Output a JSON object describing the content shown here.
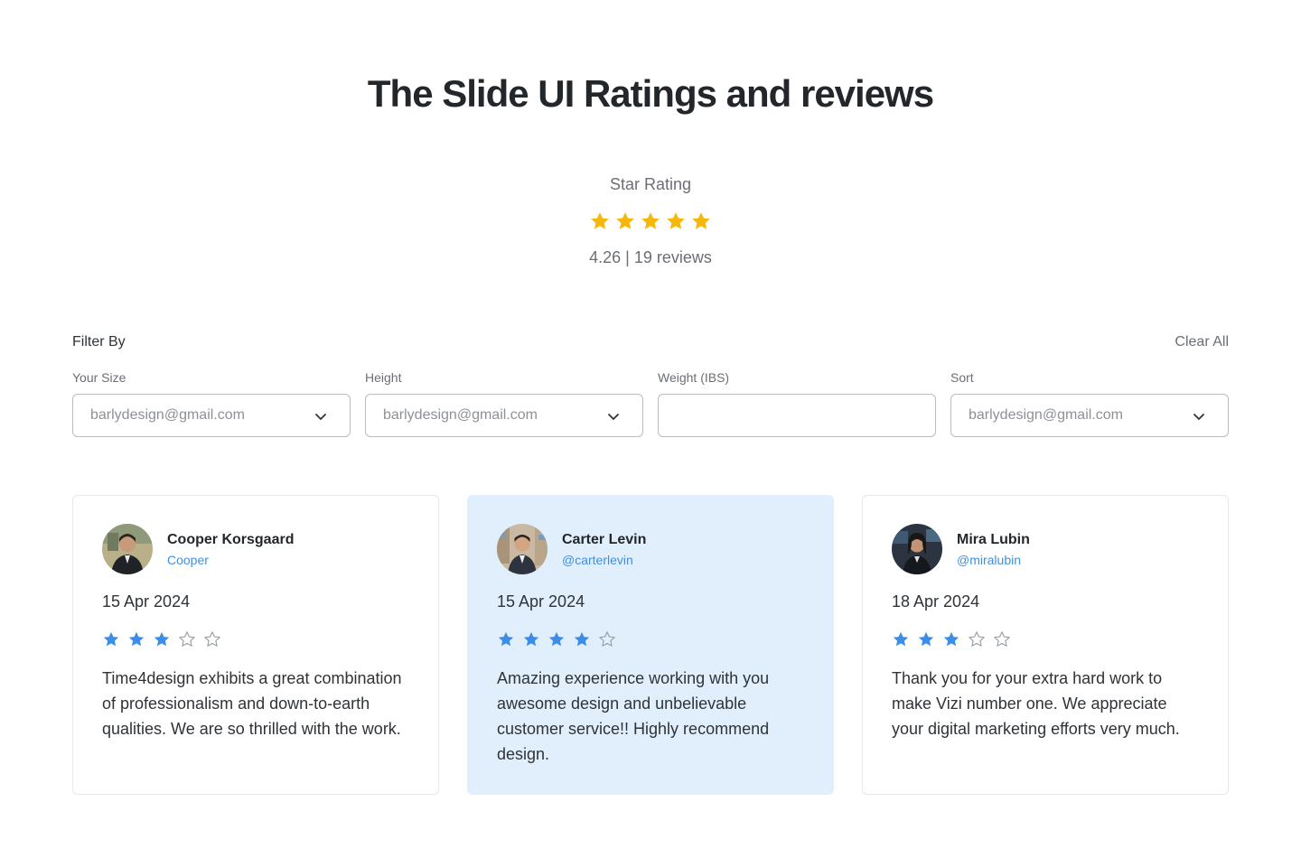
{
  "page_title": "The Slide UI Ratings and reviews",
  "summary": {
    "label": "Star Rating",
    "stars_filled": 5,
    "stars_total": 5,
    "rating_text": "4.26 | 19 reviews",
    "star_color": "#F5B70A"
  },
  "filters": {
    "title": "Filter By",
    "clear_all": "Clear All",
    "fields": [
      {
        "label": "Your Size",
        "value": "barlydesign@gmail.com",
        "has_dropdown": true
      },
      {
        "label": "Height",
        "value": "barlydesign@gmail.com",
        "has_dropdown": true
      },
      {
        "label": "Weight (IBS)",
        "value": "",
        "has_dropdown": false
      },
      {
        "label": "Sort",
        "value": "barlydesign@gmail.com",
        "has_dropdown": true
      }
    ]
  },
  "reviews": [
    {
      "name": "Cooper Korsgaard",
      "handle": "Cooper",
      "date": "15 Apr 2024",
      "rating": 3,
      "text": "Time4design exhibits a great combination of professionalism and down-to-earth qualities. We are so thrilled with the work.",
      "highlighted": false
    },
    {
      "name": "Carter Levin",
      "handle": "@carterlevin",
      "date": "15 Apr 2024",
      "rating": 4,
      "text": "Amazing experience working with you awesome design and unbelievable customer service!! Highly recommend design.",
      "highlighted": true
    },
    {
      "name": "Mira Lubin",
      "handle": "@miralubin",
      "date": "18 Apr 2024",
      "rating": 3,
      "text": "Thank you for your extra hard work to make Vizi number one. We appreciate your digital marketing efforts very much.",
      "highlighted": false
    }
  ],
  "colors": {
    "card_star": "#3B8EE8",
    "empty_star": "#9AA0A6",
    "handle": "#3F8FE0",
    "highlight_bg": "#E1EFFC"
  }
}
